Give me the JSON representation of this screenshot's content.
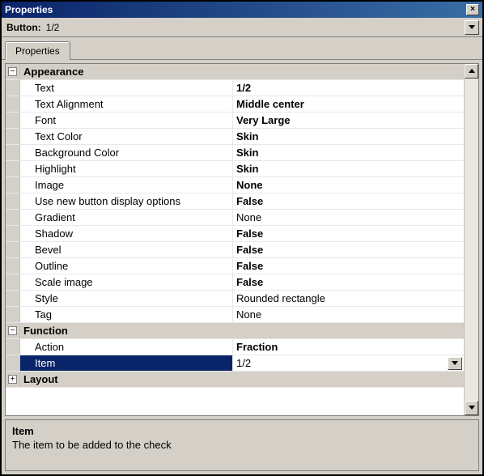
{
  "window": {
    "title": "Properties"
  },
  "object": {
    "type_label": "Button:",
    "name": "1/2"
  },
  "tabs": [
    {
      "label": "Properties"
    }
  ],
  "categories": [
    {
      "name": "Appearance",
      "expanded": true,
      "props": [
        {
          "label": "Text",
          "value": "1/2",
          "bold": true
        },
        {
          "label": "Text Alignment",
          "value": "Middle center",
          "bold": true
        },
        {
          "label": "Font",
          "value": "Very Large",
          "bold": true
        },
        {
          "label": "Text Color",
          "value": "Skin",
          "bold": true
        },
        {
          "label": "Background Color",
          "value": "Skin",
          "bold": true
        },
        {
          "label": "Highlight",
          "value": "Skin",
          "bold": true
        },
        {
          "label": "Image",
          "value": "None",
          "bold": true
        },
        {
          "label": "Use new button display options",
          "value": "False",
          "bold": true
        },
        {
          "label": "Gradient",
          "value": "None",
          "bold": false
        },
        {
          "label": "Shadow",
          "value": "False",
          "bold": true
        },
        {
          "label": "Bevel",
          "value": "False",
          "bold": true
        },
        {
          "label": "Outline",
          "value": "False",
          "bold": true
        },
        {
          "label": "Scale image",
          "value": "False",
          "bold": true
        },
        {
          "label": "Style",
          "value": "Rounded rectangle",
          "bold": false
        },
        {
          "label": "Tag",
          "value": "None",
          "bold": false
        }
      ]
    },
    {
      "name": "Function",
      "expanded": true,
      "props": [
        {
          "label": "Action",
          "value": "Fraction",
          "bold": true
        },
        {
          "label": "Item",
          "value": "1/2",
          "bold": false,
          "selected": true,
          "dropdown": true
        }
      ]
    },
    {
      "name": "Layout",
      "expanded": false,
      "props": []
    }
  ],
  "help": {
    "title": "Item",
    "description": "The item to be added to the check"
  },
  "glyphs": {
    "minus": "−",
    "plus": "+",
    "close": "×"
  }
}
